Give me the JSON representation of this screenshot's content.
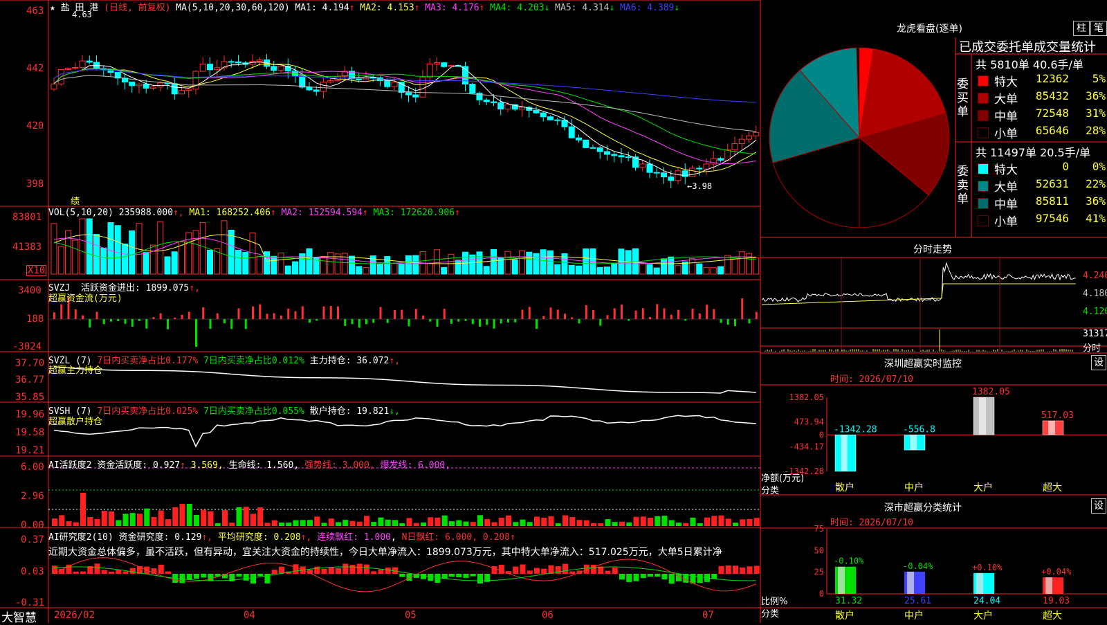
{
  "header": {
    "star": "★",
    "stock_name": "盐 田 港",
    "mode": "(日线, 前复权)",
    "ma_label": "MA(5,10,20,30,60,120)",
    "ma": [
      {
        "label": "MA1:",
        "value": "4.194",
        "arrow": "↑",
        "color": "#ffffff"
      },
      {
        "label": "MA2:",
        "value": "4.153",
        "arrow": "↑",
        "color": "#ffff40"
      },
      {
        "label": "MA3:",
        "value": "4.176",
        "arrow": "↑",
        "color": "#ff40ff"
      },
      {
        "label": "MA4:",
        "value": "4.203",
        "arrow": "↓",
        "color": "#00e000"
      },
      {
        "label": "MA5:",
        "value": "4.314",
        "arrow": "↓",
        "color": "#c0c0c0"
      },
      {
        "label": "MA6:",
        "value": "4.389",
        "arrow": "↓",
        "color": "#4040ff"
      }
    ]
  },
  "price_axis": [
    "463",
    "442",
    "420",
    "398"
  ],
  "price_marks": {
    "high": "4.63",
    "low": "←3.98",
    "perf": "绩"
  },
  "vol": {
    "axis": [
      "83801",
      "41383",
      "X10"
    ],
    "legend_title": "VOL(5,10,20)",
    "legend_value": "235988.000",
    "items": [
      {
        "label": "MA1:",
        "value": "168252.406",
        "arrow": "↑",
        "color": "#ffff40"
      },
      {
        "label": "MA2:",
        "value": "152594.594",
        "arrow": "↑",
        "color": "#ff40ff"
      },
      {
        "label": "MA3:",
        "value": "172620.906",
        "arrow": "↑",
        "color": "#00e000"
      }
    ]
  },
  "svzj": {
    "axis": [
      "3400",
      "188",
      "-3024"
    ],
    "title": "SVZJ",
    "label": "活跃资金进出:",
    "value": "1899.075",
    "arrow": "↑,",
    "sub": "超赢资金流(万元)"
  },
  "svzl": {
    "axis": [
      "37.70",
      "36.77",
      "35.85"
    ],
    "title": "SVZL (7)",
    "a": "7日内买卖净占比0.177%",
    "b": "7日内买卖净占比0.012%",
    "c": "主力持仓: 36.072",
    "arrow": "↑,",
    "sub": "超赢主力持仓"
  },
  "svsh": {
    "axis": [
      "19.96",
      "19.58",
      "19.21"
    ],
    "title": "SVSH (7)",
    "a": "7日内买卖净占比0.025%",
    "b": "7日内买卖净占比0.055%",
    "c": "散户持仓: 19.821",
    "arrow": "↓,",
    "sub": "超赢散户持仓"
  },
  "ai_active": {
    "axis": [
      "6.00",
      "2.96",
      "0.00"
    ],
    "title": "AI活跃度2",
    "label": "资金活跃度: 0.927",
    "v2": "3.569,",
    "life": "生命线: 1.560,",
    "strong": "强势线: 3.000,",
    "burst": "爆发线: 6.000,"
  },
  "ai_research": {
    "axis": [
      "0.37",
      "0.03",
      "-0.31"
    ],
    "title": "AI研究度2(10)",
    "label": "资金研究度: 0.129",
    "avg": "平均研究度: 0.208",
    "cont": "连续飘红: 1.000",
    "n": "N日飘红: 6.000,",
    "last": "0.208",
    "comment": "近期大资金总体偏多，虽不活跃，但有异动，宜关注大资金的持续性，今日大单净流入：1899.073万元，其中特大单净流入：517.025万元，大单5日累计净"
  },
  "bottom_axis": {
    "brand": "大智慧",
    "dates": [
      "2026/02",
      "04",
      "05",
      "06",
      "07"
    ]
  },
  "dragon": {
    "title": "龙虎看盘(逐单)",
    "buttons": [
      "柱",
      "笔"
    ],
    "subtitle": "已成交委托单成交量统计",
    "buy": {
      "label": "委买单",
      "summary": "共 5810单 40.6手/单",
      "rows": [
        {
          "name": "特大",
          "vol": "12362",
          "pct": "5%",
          "color": "#ff0000"
        },
        {
          "name": "大单",
          "vol": "85432",
          "pct": "36%",
          "color": "#b00000"
        },
        {
          "name": "中单",
          "vol": "72548",
          "pct": "31%",
          "color": "#800000"
        },
        {
          "name": "小单",
          "vol": "65646",
          "pct": "28%",
          "color": "#000000"
        }
      ]
    },
    "sell": {
      "label": "委卖单",
      "summary": "共 11497单 20.5手/单",
      "rows": [
        {
          "name": "特大",
          "vol": "0",
          "pct": "0%",
          "color": "#00ffff"
        },
        {
          "name": "大单",
          "vol": "52631",
          "pct": "22%",
          "color": "#008888"
        },
        {
          "name": "中单",
          "vol": "85811",
          "pct": "36%",
          "color": "#006c6c"
        },
        {
          "name": "小单",
          "vol": "97546",
          "pct": "41%",
          "color": "#000000"
        }
      ]
    }
  },
  "intraday": {
    "title": "分时走势",
    "axis": [
      "4.240",
      "4.180",
      "4.120",
      "31317",
      "分时"
    ]
  },
  "sz_monitor": {
    "title": "深圳超赢实时监控",
    "btn": "设",
    "time": "时间: 2026/07/10",
    "axis": [
      "1382.05",
      "473.94",
      "0",
      "-434.17",
      "-1342.28"
    ],
    "ylabel": "净额(万元)",
    "xlabel": "分类",
    "chart_data": {
      "type": "bar",
      "categories": [
        "散户",
        "中户",
        "大户",
        "超大"
      ],
      "values": [
        -1342.28,
        -556.8,
        1382.05,
        517.03
      ],
      "value_labels": [
        "-1342.28",
        "-556.8",
        "1382.05",
        "517.03"
      ],
      "ylim": [
        -1342.28,
        1382.05
      ]
    }
  },
  "sz_class": {
    "title": "深市超赢分类统计",
    "btn": "设",
    "time": "时间: 2026/07/10",
    "axis": [
      "75",
      "50",
      "25",
      "0"
    ],
    "ylabel": "比例%",
    "xlabel": "分类",
    "chart_data": {
      "type": "bar",
      "categories": [
        "散户",
        "中户",
        "大户",
        "超大"
      ],
      "values": [
        31.32,
        25.61,
        24.04,
        19.03
      ],
      "changes": [
        "-0.10%",
        "-0.04%",
        "+0.10%",
        "+0.04%"
      ],
      "value_labels": [
        "31.32",
        "25.61",
        "24.04",
        "19.03"
      ],
      "ylim": [
        0,
        75
      ]
    }
  }
}
